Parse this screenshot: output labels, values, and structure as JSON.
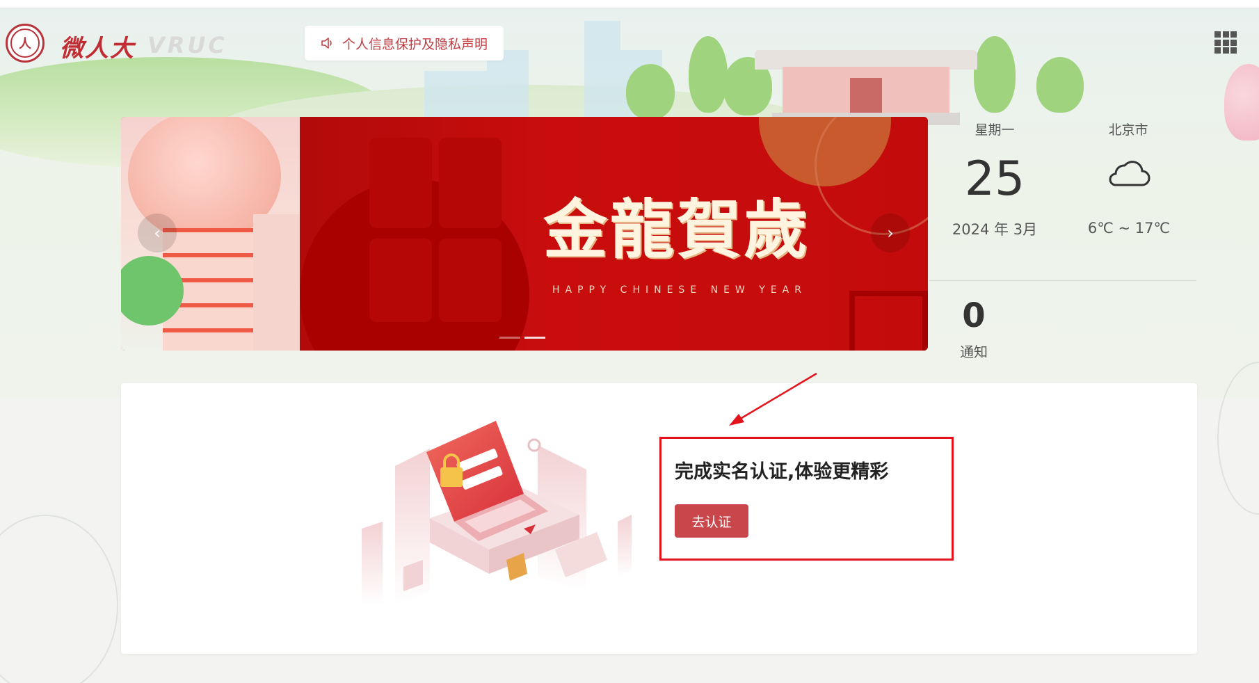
{
  "header": {
    "logo_seal_text": "人",
    "logo_cn": "微人大",
    "logo_en": "VRUC",
    "privacy_notice": "个人信息保护及隐私声明"
  },
  "carousel": {
    "slide_title": "金龍賀歲",
    "slide_subtitle": "HAPPY CHINESE NEW YEAR",
    "prev_label": "‹",
    "next_label": "›",
    "total_slides": 2,
    "active_slide": 2
  },
  "info": {
    "weekday": "星期一",
    "city": "北京市",
    "day": "25",
    "year_month": "2024 年 3月",
    "weather_icon": "cloud-icon",
    "temperature": "6℃ ~ 17℃",
    "notice_count": "0",
    "notice_label": "通知"
  },
  "auth": {
    "title": "完成实名认证,体验更精彩",
    "button_label": "去认证"
  },
  "colors": {
    "brand": "#c22c33",
    "button": "#c9464a",
    "highlight": "#e3131b"
  }
}
